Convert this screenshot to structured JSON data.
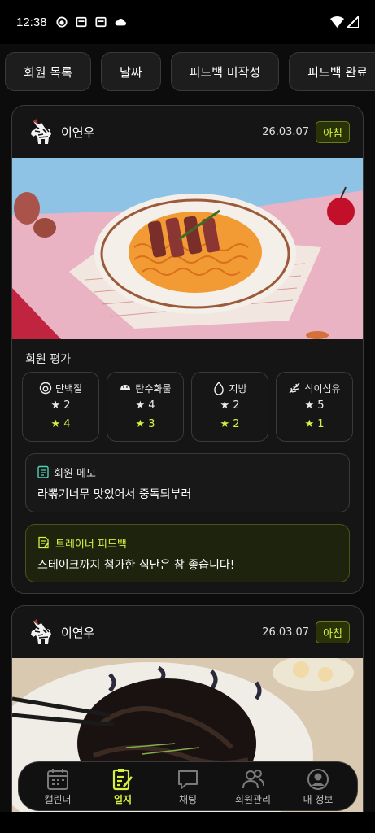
{
  "status_bar": {
    "time": "12:38"
  },
  "filters": [
    "회원 목록",
    "날짜",
    "피드백 미작성",
    "피드백 완료"
  ],
  "entries": [
    {
      "member": "이연우",
      "date": "26.03.07",
      "meal": "아침",
      "rating_title": "회원 평가",
      "nutrients": [
        {
          "icon": "protein-icon",
          "label": "단백질",
          "member_stars": "★ 2",
          "trainer_stars": "★ 4"
        },
        {
          "icon": "carb-icon",
          "label": "탄수화물",
          "member_stars": "★ 4",
          "trainer_stars": "★ 3"
        },
        {
          "icon": "fat-icon",
          "label": "지방",
          "member_stars": "★ 2",
          "trainer_stars": "★ 2"
        },
        {
          "icon": "fiber-icon",
          "label": "식이섬유",
          "member_stars": "★ 5",
          "trainer_stars": "★ 1"
        }
      ],
      "memo_title": "회원 메모",
      "memo": "라뽂기너무 맛있어서 중독되부러",
      "feedback_title": "트레이너 피드백",
      "feedback": "스테이크까지 첨가한 식단은 참 좋습니다!"
    },
    {
      "member": "이연우",
      "date": "26.03.07",
      "meal": "아침"
    }
  ],
  "nav": [
    {
      "label": "캘린더",
      "icon": "calendar-icon"
    },
    {
      "label": "일지",
      "icon": "journal-icon",
      "active": true
    },
    {
      "label": "채팅",
      "icon": "chat-icon"
    },
    {
      "label": "회원관리",
      "icon": "members-icon"
    },
    {
      "label": "내 정보",
      "icon": "profile-icon"
    }
  ],
  "colors": {
    "accent": "#d8f040",
    "background": "#0c0c0c",
    "card": "#151515"
  }
}
